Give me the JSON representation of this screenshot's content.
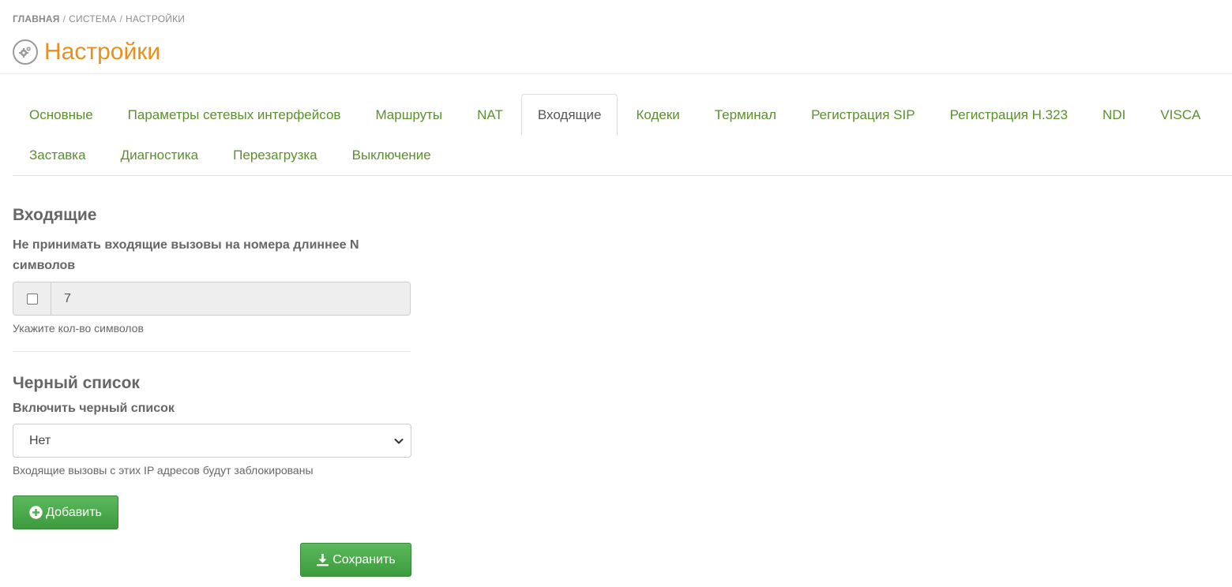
{
  "breadcrumb": {
    "home": "ГЛАВНАЯ",
    "system": "СИСТЕМА",
    "settings": "НАСТРОЙКИ",
    "separator": "/"
  },
  "page": {
    "title": "Настройки",
    "icon": "gears-icon",
    "title_color": "#e8901f"
  },
  "tabs": {
    "row1": [
      "Основные",
      "Параметры сетевых интерфейсов",
      "Маршруты",
      "NAT",
      "Входящие",
      "Кодеки",
      "Терминал",
      "Регистрация SIP",
      "Регистрация H.323",
      "NDI",
      "VISCA"
    ],
    "row2": [
      "Заставка",
      "Диагностика",
      "Перезагрузка",
      "Выключение"
    ],
    "active": "Входящие",
    "link_color": "#5c8f2e"
  },
  "incoming": {
    "title": "Входящие",
    "limit_label": "Не принимать входящие вызовы на номера длиннее N символов",
    "limit_checked": false,
    "limit_value": "7",
    "limit_help": "Укажите кол-во символов"
  },
  "blacklist": {
    "title": "Черный список",
    "enable_label": "Включить черный список",
    "enable_value": "Нет",
    "help": "Входящие вызовы с этих IP адресов будут заблокированы",
    "add_button": "Добавить",
    "add_icon": "plus-circle-icon"
  },
  "actions": {
    "save_button": "Сохранить",
    "save_icon": "download-icon",
    "button_color": "#4cae4c"
  }
}
